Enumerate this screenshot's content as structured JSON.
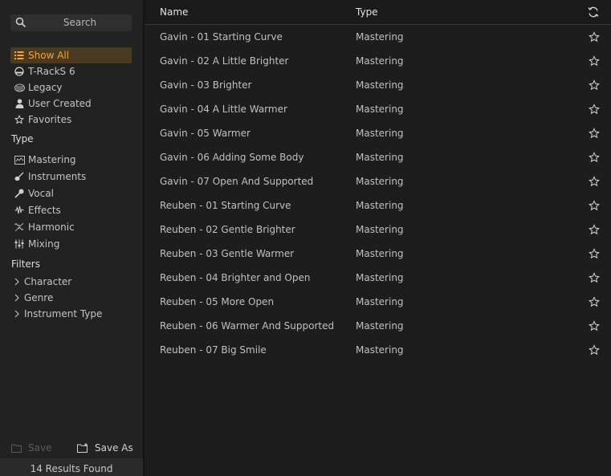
{
  "sidebar": {
    "search_label": "Search",
    "nav": [
      {
        "label": "Show All",
        "icon": "list-icon",
        "active": true
      },
      {
        "label": "T-RackS 6",
        "icon": "trackS-icon",
        "active": false
      },
      {
        "label": "Legacy",
        "icon": "legacy-icon",
        "active": false
      },
      {
        "label": "User Created",
        "icon": "user-icon",
        "active": false
      },
      {
        "label": "Favorites",
        "icon": "star-icon",
        "active": false
      }
    ],
    "type_title": "Type",
    "types": [
      {
        "label": "Mastering",
        "icon": "mastering-icon"
      },
      {
        "label": "Instruments",
        "icon": "guitar-icon"
      },
      {
        "label": "Vocal",
        "icon": "microphone-icon"
      },
      {
        "label": "Effects",
        "icon": "effects-icon"
      },
      {
        "label": "Harmonic",
        "icon": "harmonic-icon"
      },
      {
        "label": "Mixing",
        "icon": "faders-icon"
      }
    ],
    "filters_title": "Filters",
    "filters": [
      {
        "label": "Character"
      },
      {
        "label": "Genre"
      },
      {
        "label": "Instrument Type"
      }
    ],
    "save_label": "Save",
    "save_as_label": "Save As",
    "results_text": "14 Results Found"
  },
  "table": {
    "col_name": "Name",
    "col_type": "Type",
    "rows": [
      {
        "name": "Gavin - 01 Starting Curve",
        "type": "Mastering"
      },
      {
        "name": "Gavin - 02 A Little Brighter",
        "type": "Mastering"
      },
      {
        "name": "Gavin - 03 Brighter",
        "type": "Mastering"
      },
      {
        "name": "Gavin - 04 A Little Warmer",
        "type": "Mastering"
      },
      {
        "name": "Gavin - 05 Warmer",
        "type": "Mastering"
      },
      {
        "name": "Gavin - 06 Adding Some Body",
        "type": "Mastering"
      },
      {
        "name": "Gavin - 07 Open And Supported",
        "type": "Mastering"
      },
      {
        "name": "Reuben - 01 Starting Curve",
        "type": "Mastering"
      },
      {
        "name": "Reuben - 02 Gentle Brighter",
        "type": "Mastering"
      },
      {
        "name": "Reuben - 03 Gentle Warmer",
        "type": "Mastering"
      },
      {
        "name": "Reuben - 04 Brighter and Open",
        "type": "Mastering"
      },
      {
        "name": "Reuben - 05 More Open",
        "type": "Mastering"
      },
      {
        "name": "Reuben - 06 Warmer And Supported",
        "type": "Mastering"
      },
      {
        "name": "Reuben - 07 Big Smile",
        "type": "Mastering"
      }
    ]
  },
  "colors": {
    "accent": "#f0a63a",
    "active_bg": "#4a3a22",
    "background": "#1d1d1d",
    "sidebar_bg": "#222222"
  }
}
